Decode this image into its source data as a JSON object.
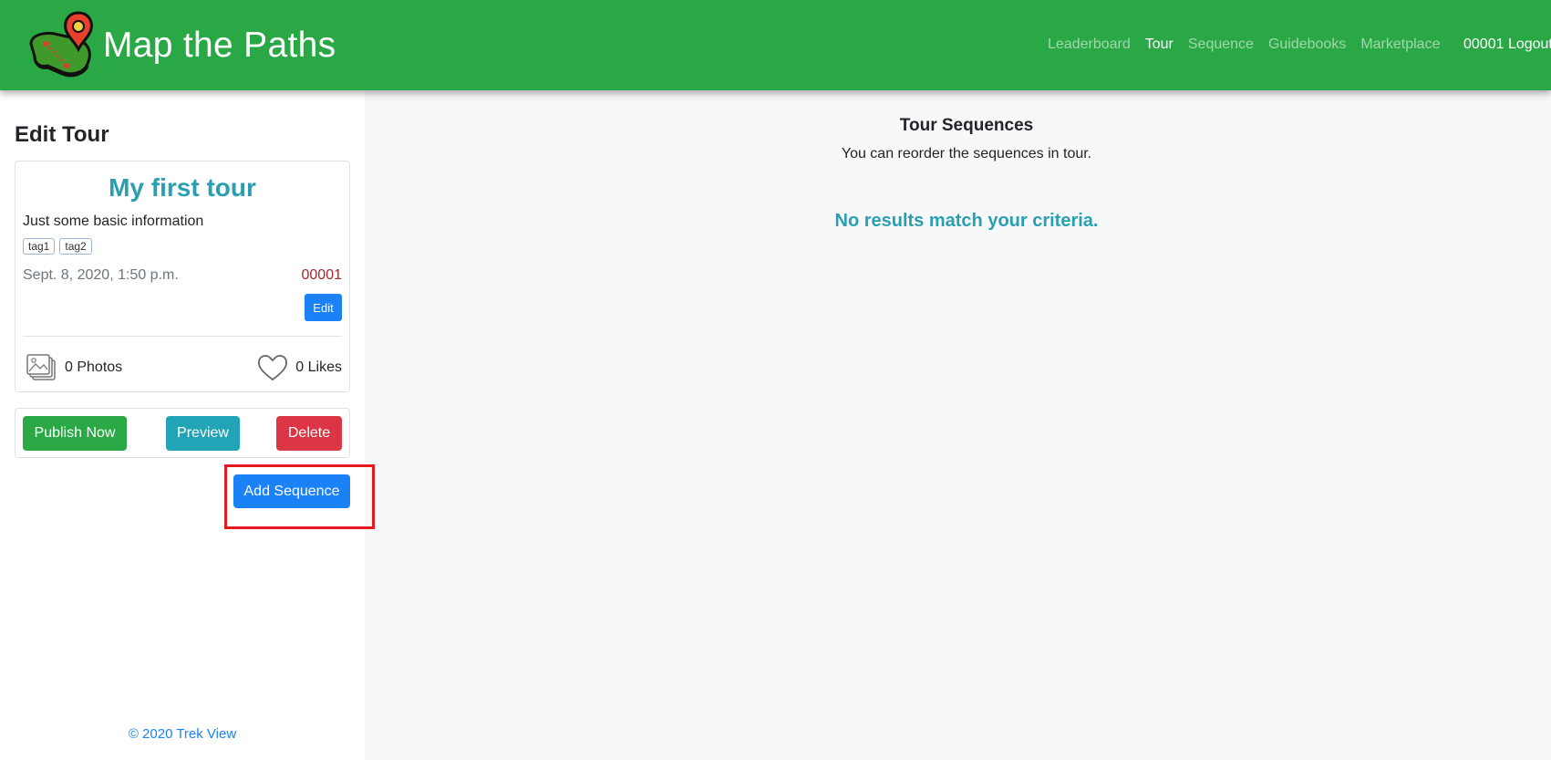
{
  "header": {
    "brand_name": "Map the Paths",
    "brand_logo_icon": "map-pin-boot-icon",
    "nav": [
      {
        "label": "Leaderboard",
        "active": false
      },
      {
        "label": "Tour",
        "active": true
      },
      {
        "label": "Sequence",
        "active": false
      },
      {
        "label": "Guidebooks",
        "active": false
      },
      {
        "label": "Marketplace",
        "active": false
      }
    ],
    "user": "00001 Logout"
  },
  "sidebar": {
    "title": "Edit Tour",
    "tour": {
      "name": "My first tour",
      "description": "Just some basic information",
      "tags": [
        "tag1",
        "tag2"
      ],
      "date": "Sept. 8, 2020, 1:50 p.m.",
      "owner_id": "00001",
      "edit_label": "Edit",
      "photos": "0 Photos",
      "likes": "0 Likes"
    },
    "actions": {
      "publish_label": "Publish Now",
      "preview_label": "Preview",
      "delete_label": "Delete"
    },
    "add_sequence_label": "Add Sequence",
    "footer": "© 2020 Trek View"
  },
  "main": {
    "title": "Tour Sequences",
    "subtitle": "You can reorder the sequences in tour.",
    "empty_message": "No results match your criteria."
  },
  "colors": {
    "brand_green": "#2aa846",
    "primary_blue": "#1a82f6",
    "info_teal": "#21a4b6",
    "danger_red": "#dc3545",
    "title_teal": "#2a9fb2",
    "highlight": "#e8191e"
  }
}
